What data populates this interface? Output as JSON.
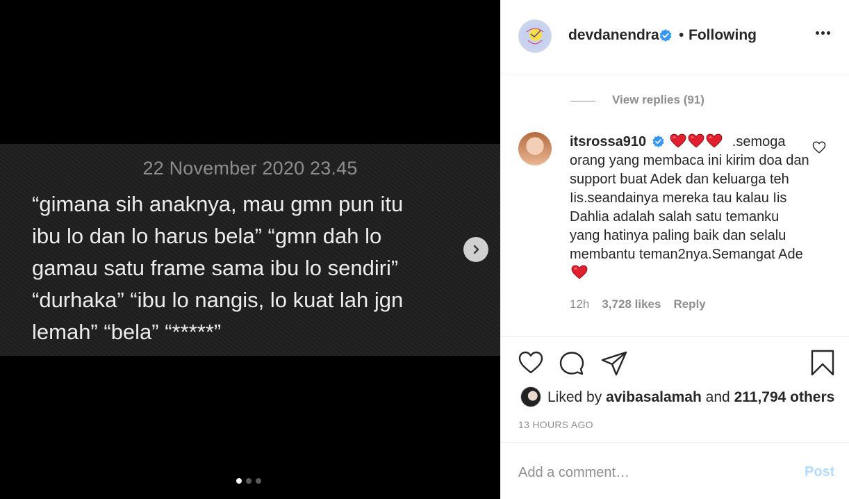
{
  "media": {
    "date": "22 November 2020 23.45",
    "lines": [
      "“gimana sih anaknya, mau gmn pun itu",
      "ibu lo dan lo harus bela” “gmn dah lo",
      "gamau satu frame sama ibu lo sendiri”",
      "“durhaka” “ibu lo nangis, lo kuat lah jgn",
      "lemah” “bela” “*****”"
    ],
    "next_icon": "chevron-right-icon",
    "carousel": {
      "count": 3,
      "active_index": 0
    }
  },
  "header": {
    "username": "devdanendra",
    "separator": "•",
    "follow_status": "Following",
    "more_icon": "more-horizontal-icon"
  },
  "replies": {
    "label": "View replies (91)"
  },
  "comment": {
    "username": "itsrossa910",
    "text_line1": ".semoga",
    "text_rest": "orang yang membaca ini kirim doa dan support buat Adek dan keluarga teh Iis.seandainya mereka tau kalau Iis Dahlia adalah salah satu temanku yang hatinya paling baik dan selalu membantu teman2nya.Semangat Ade",
    "time": "12h",
    "likes": "3,728 likes",
    "reply_label": "Reply"
  },
  "actions": {
    "liked_prefix": "Liked by",
    "liked_user": "avibasalamah",
    "liked_and": "and",
    "liked_others": "211,794 others",
    "timestamp": "13 HOURS AGO"
  },
  "add_comment": {
    "placeholder": "Add a comment…",
    "post_label": "Post"
  },
  "colors": {
    "verified": "#3897f0",
    "heart_red": "#e0202f",
    "post_disabled": "#b3dbff",
    "muted": "#8e8e8e"
  }
}
